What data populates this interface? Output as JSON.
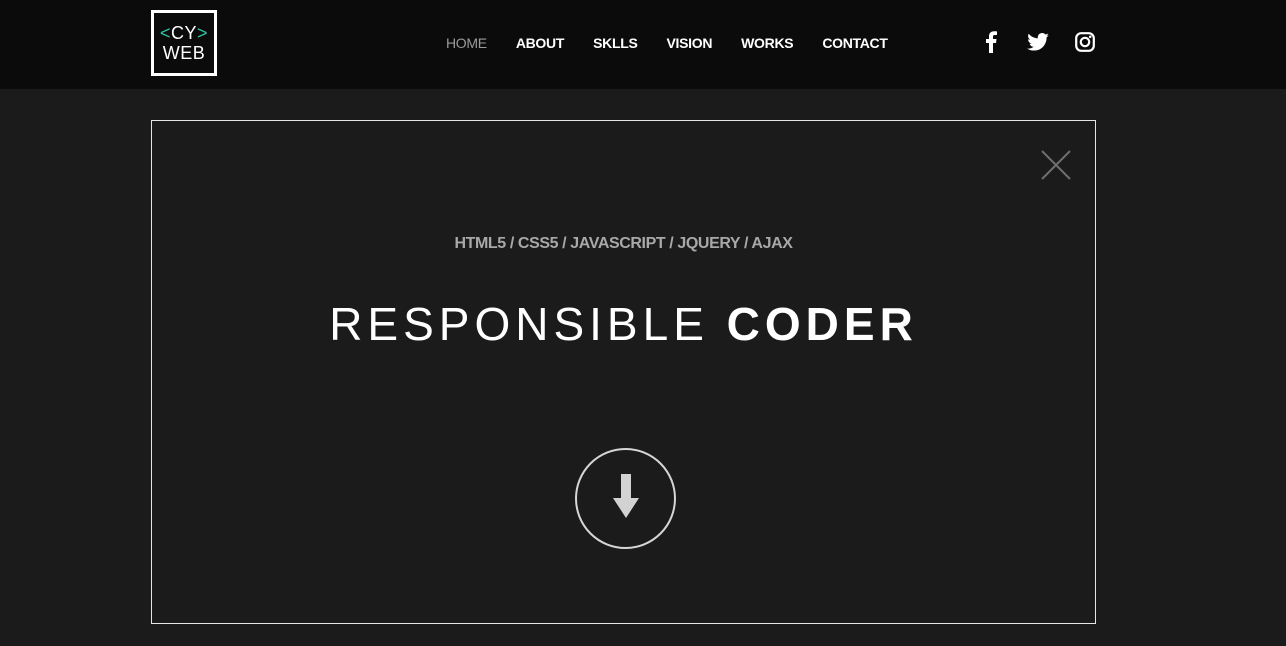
{
  "logo": {
    "line1_open": "<",
    "line1_text": "CY",
    "line1_close": ">",
    "line2": "WEB",
    "accent_color": "#2ec4a0"
  },
  "nav": {
    "items": [
      {
        "label": "HOME",
        "active": true
      },
      {
        "label": "ABOUT"
      },
      {
        "label": "SKLLS"
      },
      {
        "label": "VISION"
      },
      {
        "label": "WORKS"
      },
      {
        "label": "CONTACT"
      }
    ]
  },
  "social": {
    "icons": [
      "facebook-icon",
      "twitter-icon",
      "instagram-icon"
    ]
  },
  "hero": {
    "skills": "HTML5 / CSS5 / JAVASCRIPT / JQUERY / AJAX",
    "headline_light": "RESPONSIBLE",
    "headline_bold": "CODER",
    "close_icon": "close-icon",
    "scroll_icon": "arrow-down-icon"
  },
  "colors": {
    "background": "#1b1b1b",
    "topbar": "#0b0b0b",
    "text": "#ffffff",
    "muted": "#a8a8a8"
  }
}
